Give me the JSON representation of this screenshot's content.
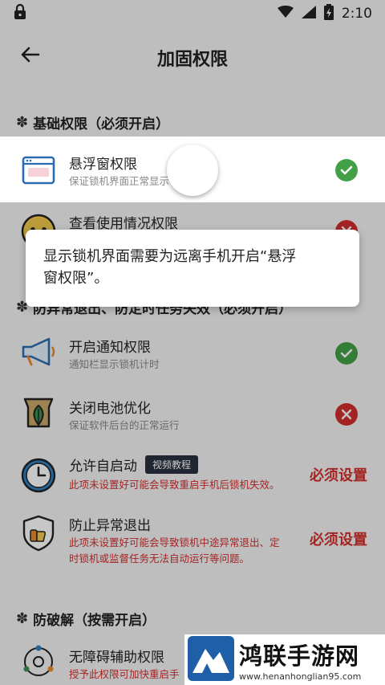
{
  "status_bar": {
    "time": "2:10",
    "icons": [
      "lock-icon",
      "wifi-icon",
      "signal-icon",
      "battery-icon"
    ]
  },
  "header": {
    "title": "加固权限",
    "back_icon": "back-arrow-icon"
  },
  "sections": [
    {
      "title": "基础权限（必须开启）"
    },
    {
      "title": "防异常退出、防定时任务失效（必须开启）"
    },
    {
      "title": "防破解（按需开启）"
    }
  ],
  "items": [
    {
      "title": "悬浮窗权限",
      "subtitle": "保证锁机界面正常显示",
      "status": "ok",
      "icon": "floating-window-icon"
    },
    {
      "title": "查看使用情况权限",
      "subtitle": "",
      "status": "bad",
      "icon": "usage-eye-icon"
    },
    {
      "title": "开启通知权限",
      "subtitle": "通知栏显示锁机计时",
      "status": "ok",
      "icon": "megaphone-icon"
    },
    {
      "title": "关闭电池优化",
      "subtitle": "保证软件后台的正常运行",
      "status": "bad",
      "icon": "battery-leaf-icon"
    },
    {
      "title": "允许自启动",
      "tag": "视频教程",
      "subtitle": "此项未设置好可能会导致重启手机后锁机失效。",
      "action": "必须设置",
      "icon": "clock-icon"
    },
    {
      "title": "防止异常退出",
      "subtitle_line1": "此项未设置好可能会导致锁机中途异常退出、定",
      "subtitle_line2": "时锁机或监督任务无法自动运行等问题。",
      "action": "必须设置",
      "icon": "shield-hand-icon"
    },
    {
      "title": "无障碍辅助权限",
      "subtitle": "授予此权限可加快重启手",
      "icon": "accessibility-icon"
    }
  ],
  "toast": {
    "line1": "显示锁机界面需要为远离手机开启“悬浮",
    "line2": "窗权限”。"
  },
  "watermark": {
    "title": "鸿联手游网",
    "url": "www.henanhonglian95.com"
  },
  "colors": {
    "ok": "#43a047",
    "bad": "#d32f2f",
    "accent_blue": "#2b6cb0",
    "page_bg": "#f4f4f4"
  }
}
